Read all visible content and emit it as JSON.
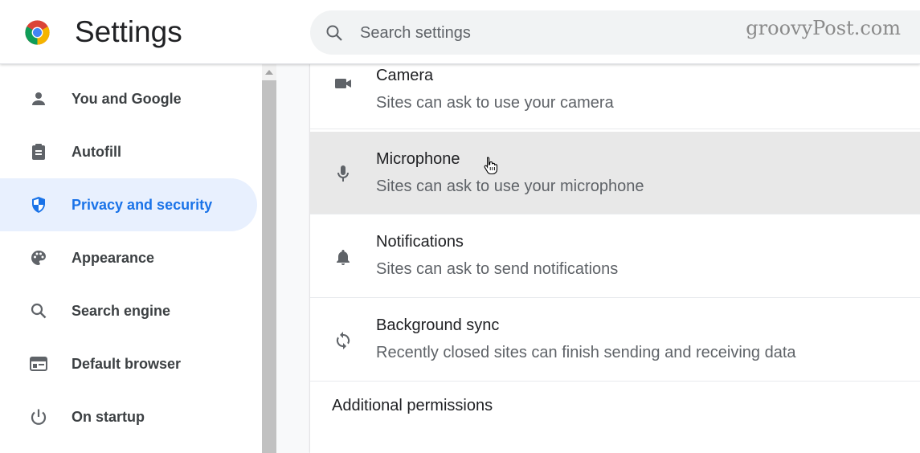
{
  "header": {
    "title": "Settings",
    "search_placeholder": "Search settings",
    "watermark": "groovyPost.com"
  },
  "sidebar": {
    "items": [
      {
        "label": "You and Google",
        "icon": "person-icon"
      },
      {
        "label": "Autofill",
        "icon": "clipboard-icon"
      },
      {
        "label": "Privacy and security",
        "icon": "shield-icon",
        "active": true
      },
      {
        "label": "Appearance",
        "icon": "palette-icon"
      },
      {
        "label": "Search engine",
        "icon": "search-icon"
      },
      {
        "label": "Default browser",
        "icon": "browser-window-icon"
      },
      {
        "label": "On startup",
        "icon": "power-icon"
      }
    ]
  },
  "permissions": [
    {
      "title": "Camera",
      "desc": "Sites can ask to use your camera",
      "icon": "camera-icon"
    },
    {
      "title": "Microphone",
      "desc": "Sites can ask to use your microphone",
      "icon": "microphone-icon",
      "hovered": true
    },
    {
      "title": "Notifications",
      "desc": "Sites can ask to send notifications",
      "icon": "bell-icon"
    },
    {
      "title": "Background sync",
      "desc": "Recently closed sites can finish sending and receiving data",
      "icon": "sync-icon"
    }
  ],
  "additional_permissions": "Additional permissions",
  "colors": {
    "accent": "#1a73e8",
    "active_bg": "#e8f0fe",
    "hover_row_bg": "#e8e8e8"
  }
}
